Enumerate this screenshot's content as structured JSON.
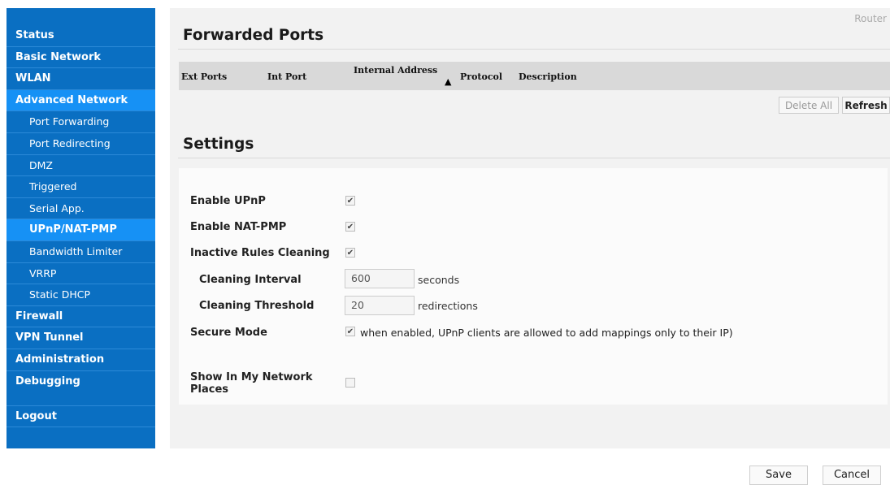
{
  "sidebar": {
    "items": [
      {
        "label": "Status"
      },
      {
        "label": "Basic Network"
      },
      {
        "label": "WLAN"
      },
      {
        "label": "Advanced Network"
      }
    ],
    "sub_items": [
      {
        "label": "Port Forwarding"
      },
      {
        "label": "Port Redirecting"
      },
      {
        "label": "DMZ"
      },
      {
        "label": "Triggered"
      },
      {
        "label": "Serial App."
      },
      {
        "label": "UPnP/NAT-PMP"
      },
      {
        "label": "Bandwidth Limiter"
      },
      {
        "label": "VRRP"
      },
      {
        "label": "Static DHCP"
      }
    ],
    "items_after": [
      {
        "label": "Firewall"
      },
      {
        "label": "VPN Tunnel"
      },
      {
        "label": "Administration"
      },
      {
        "label": "Debugging"
      }
    ],
    "logout": "Logout"
  },
  "header": {
    "router_label": "Router"
  },
  "forwarded_ports": {
    "title": "Forwarded Ports",
    "columns": [
      "Ext Ports",
      "Int Port",
      "Internal Address",
      "Protocol",
      "Description"
    ],
    "delete_all_label": "Delete All",
    "refresh_label": "Refresh"
  },
  "settings": {
    "title": "Settings",
    "enable_upnp": {
      "label": "Enable UPnP",
      "checked": true
    },
    "enable_natpmp": {
      "label": "Enable NAT-PMP",
      "checked": true
    },
    "inactive_rules": {
      "label": "Inactive Rules Cleaning",
      "checked": true
    },
    "cleaning_interval": {
      "label": "Cleaning Interval",
      "value": "600",
      "unit": "seconds"
    },
    "cleaning_threshold": {
      "label": "Cleaning Threshold",
      "value": "20",
      "unit": "redirections"
    },
    "secure_mode": {
      "label": "Secure Mode",
      "checked": true,
      "note": "when enabled, UPnP clients are allowed to add mappings only to their IP)"
    },
    "show_network": {
      "label_line1": "Show In My Network",
      "label_line2": "Places",
      "checked": false
    }
  },
  "footer": {
    "save_label": "Save",
    "cancel_label": "Cancel"
  }
}
